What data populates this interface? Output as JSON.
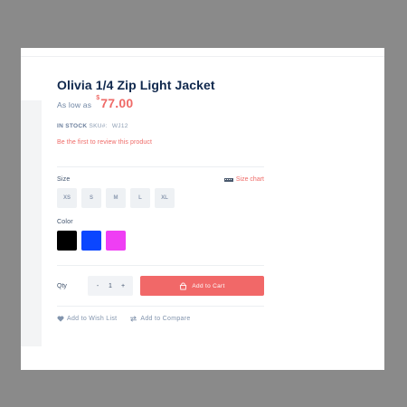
{
  "product": {
    "title": "Olivia 1/4 Zip Light Jacket",
    "price_prefix": "As low as",
    "currency": "$",
    "price": "77.00",
    "stock_status": "IN STOCK",
    "sku_label": "SKU#:",
    "sku": "WJ12",
    "review_link": "Be the first to review this product"
  },
  "size_section": {
    "label": "Size",
    "chart_link": "Size chart",
    "options": [
      "XS",
      "S",
      "M",
      "L",
      "XL"
    ]
  },
  "color_section": {
    "label": "Color",
    "swatches": [
      "#000000",
      "#0b46ff",
      "#ef3ef4"
    ]
  },
  "quantity": {
    "label": "Qty",
    "minus": "-",
    "value": "1",
    "plus": "+"
  },
  "add_to_cart": {
    "label": "Add to Cart"
  },
  "actions": {
    "wishlist": "Add to Wish List",
    "compare": "Add to Compare"
  },
  "colors": {
    "accent": "#f16868",
    "title": "#10284d",
    "price": "#ef6a67",
    "backdrop": "#8a8a8a"
  },
  "icons": {
    "size_chart": "ruler-icon",
    "add_to_cart": "shopping-bag-icon",
    "wishlist": "heart-icon",
    "compare": "compare-arrows-icon"
  }
}
